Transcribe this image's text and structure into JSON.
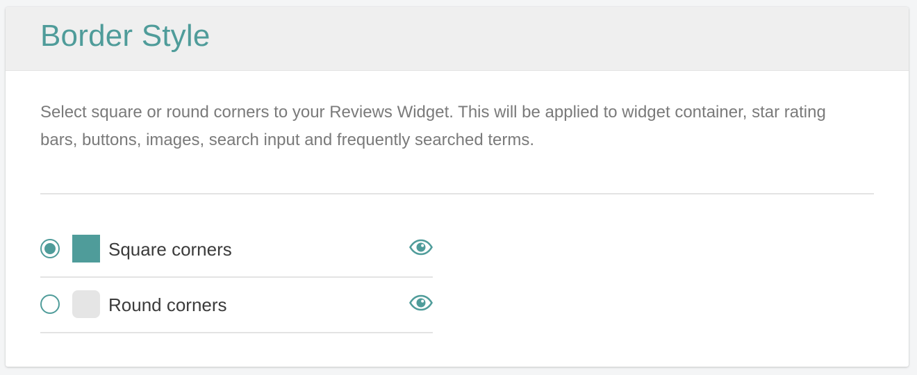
{
  "section": {
    "title": "Border Style",
    "description": "Select square or round corners to your Reviews Widget. This will be applied to widget container, star rating bars, buttons, images, search input and frequently searched terms."
  },
  "options": [
    {
      "label": "Square corners",
      "selected": true,
      "swatch": "square",
      "preview_icon": "eye-icon"
    },
    {
      "label": "Round corners",
      "selected": false,
      "swatch": "round",
      "preview_icon": "eye-icon"
    }
  ],
  "colors": {
    "accent": "#4f9c9a",
    "header_bg": "#efefef",
    "round_swatch": "#e5e5e5",
    "text": "#3b3b3b",
    "muted_text": "#7a7a7a"
  }
}
